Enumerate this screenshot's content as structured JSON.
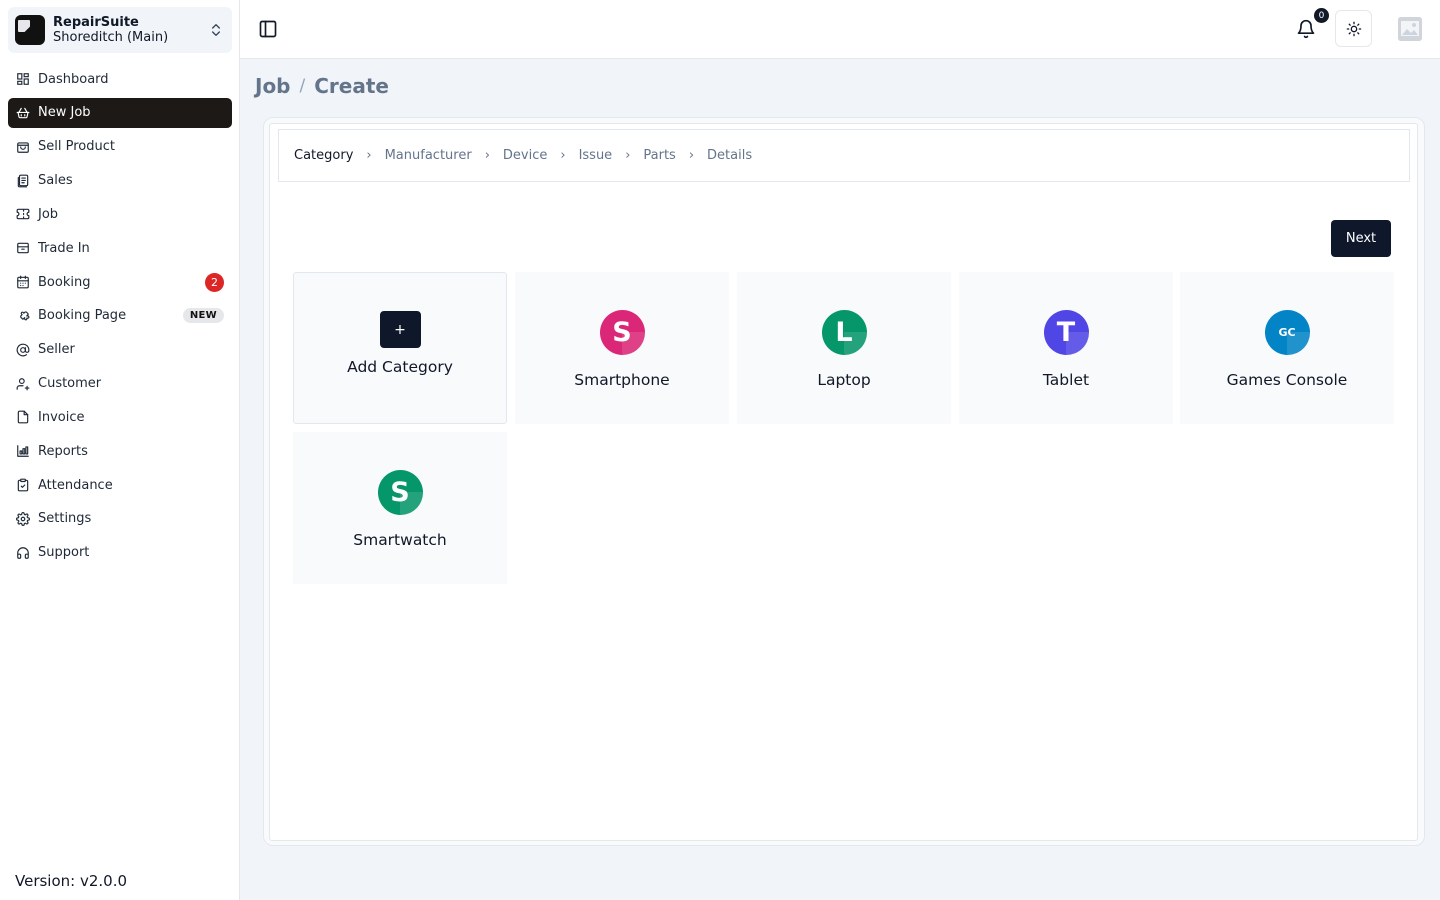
{
  "store": {
    "name": "RepairSuite",
    "branch": "Shoreditch (Main)"
  },
  "nav": [
    {
      "label": "Dashboard",
      "icon": "grid-icon"
    },
    {
      "label": "New Job",
      "icon": "basket-icon",
      "active": true
    },
    {
      "label": "Sell Product",
      "icon": "bag-icon"
    },
    {
      "label": "Sales",
      "icon": "receipt-icon"
    },
    {
      "label": "Job",
      "icon": "ticket-icon"
    },
    {
      "label": "Trade In",
      "icon": "archive-icon"
    },
    {
      "label": "Booking",
      "icon": "calendar-icon",
      "badge": "2"
    },
    {
      "label": "Booking Page",
      "icon": "puzzle-icon",
      "pill": "NEW"
    },
    {
      "label": "Seller",
      "icon": "at-icon"
    },
    {
      "label": "Customer",
      "icon": "user-icon"
    },
    {
      "label": "Invoice",
      "icon": "file-icon"
    },
    {
      "label": "Reports",
      "icon": "chart-icon"
    },
    {
      "label": "Attendance",
      "icon": "clipboard-check-icon"
    },
    {
      "label": "Settings",
      "icon": "gear-icon"
    },
    {
      "label": "Support",
      "icon": "headphones-icon"
    }
  ],
  "version": "Version: v2.0.0",
  "topbar": {
    "notifications": "0"
  },
  "breadcrumb": {
    "parent": "Job",
    "separator": "/",
    "current": "Create"
  },
  "steps": [
    "Category",
    "Manufacturer",
    "Device",
    "Issue",
    "Parts",
    "Details"
  ],
  "next_label": "Next",
  "add_tile": {
    "icon": "+",
    "label": "Add Category"
  },
  "categories": [
    {
      "initials": "S",
      "label": "Smartphone",
      "color": "#db2777"
    },
    {
      "initials": "L",
      "label": "Laptop",
      "color": "#059669"
    },
    {
      "initials": "T",
      "label": "Tablet",
      "color": "#4f46e5"
    },
    {
      "initials": "GC",
      "label": "Games Console",
      "color": "#0284c7"
    },
    {
      "initials": "S",
      "label": "Smartwatch",
      "color": "#059669"
    }
  ]
}
